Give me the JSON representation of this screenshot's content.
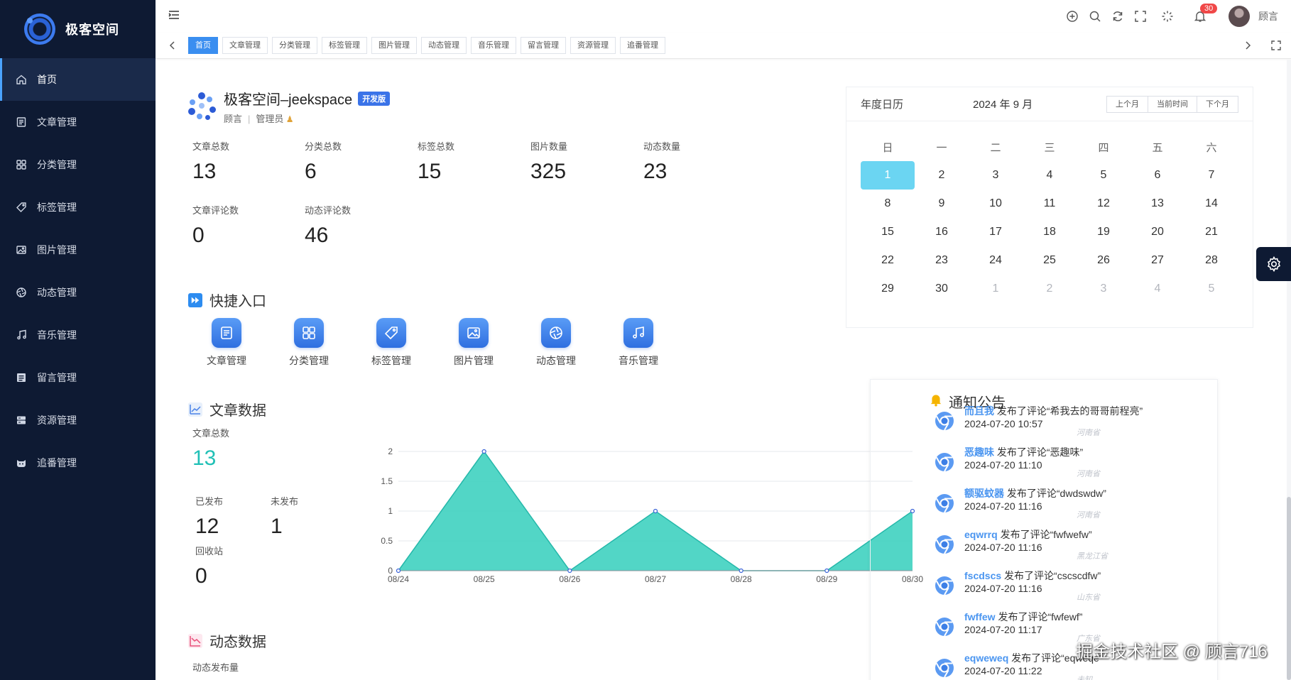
{
  "app": {
    "logo_text": "极客空间"
  },
  "sidebar": {
    "items": [
      {
        "label": "首页",
        "icon": "home-icon"
      },
      {
        "label": "文章管理",
        "icon": "article-icon"
      },
      {
        "label": "分类管理",
        "icon": "category-icon"
      },
      {
        "label": "标签管理",
        "icon": "tag-icon"
      },
      {
        "label": "图片管理",
        "icon": "image-icon"
      },
      {
        "label": "动态管理",
        "icon": "aperture-icon"
      },
      {
        "label": "音乐管理",
        "icon": "music-icon"
      },
      {
        "label": "留言管理",
        "icon": "message-icon"
      },
      {
        "label": "资源管理",
        "icon": "resource-icon"
      },
      {
        "label": "追番管理",
        "icon": "anime-icon"
      }
    ]
  },
  "topbar": {
    "badge_count": "30",
    "username": "顾言"
  },
  "tabs": [
    "首页",
    "文章管理",
    "分类管理",
    "标签管理",
    "图片管理",
    "动态管理",
    "音乐管理",
    "留言管理",
    "资源管理",
    "追番管理"
  ],
  "profile": {
    "name": "极客空间–jeekspace",
    "badge": "开发版",
    "user": "顾言",
    "role": "管理员"
  },
  "stats": [
    {
      "label": "文章总数",
      "value": "13"
    },
    {
      "label": "分类总数",
      "value": "6"
    },
    {
      "label": "标签总数",
      "value": "15"
    },
    {
      "label": "图片数量",
      "value": "325"
    },
    {
      "label": "动态数量",
      "value": "23"
    },
    {
      "label": "文章评论数",
      "value": "0"
    },
    {
      "label": "动态评论数",
      "value": "46"
    }
  ],
  "quick": {
    "title": "快捷入口",
    "items": [
      {
        "label": "文章管理",
        "icon": "article-icon"
      },
      {
        "label": "分类管理",
        "icon": "category-icon"
      },
      {
        "label": "标签管理",
        "icon": "tag-icon"
      },
      {
        "label": "图片管理",
        "icon": "image-icon"
      },
      {
        "label": "动态管理",
        "icon": "aperture-icon"
      },
      {
        "label": "音乐管理",
        "icon": "music-icon"
      }
    ]
  },
  "article_data": {
    "title": "文章数据",
    "total_label": "文章总数",
    "total": "13",
    "published_label": "已发布",
    "published": "12",
    "unpublished_label": "未发布",
    "unpublished": "1",
    "recycle_label": "回收站",
    "recycle": "0"
  },
  "dynamic_data": {
    "title": "动态数据",
    "sub_label": "动态发布量"
  },
  "chart_data": {
    "type": "area",
    "x": [
      "08/24",
      "08/25",
      "08/26",
      "08/27",
      "08/28",
      "08/29",
      "08/30"
    ],
    "values": [
      0,
      2,
      0,
      1,
      0,
      0,
      1
    ],
    "ylim": [
      0,
      2
    ],
    "yticks": [
      "0",
      "0.5",
      "1",
      "1.5",
      "2"
    ],
    "grid": true,
    "color": "#3fd1c0"
  },
  "calendar": {
    "title": "年度日历",
    "month_label": "2024 年 9 月",
    "buttons": [
      "上个月",
      "当前时间",
      "下个月"
    ],
    "weekdays": [
      "日",
      "一",
      "二",
      "三",
      "四",
      "五",
      "六"
    ],
    "days": [
      {
        "d": "1",
        "sel": true
      },
      {
        "d": "2"
      },
      {
        "d": "3"
      },
      {
        "d": "4"
      },
      {
        "d": "5"
      },
      {
        "d": "6"
      },
      {
        "d": "7"
      },
      {
        "d": "8"
      },
      {
        "d": "9"
      },
      {
        "d": "10"
      },
      {
        "d": "11"
      },
      {
        "d": "12"
      },
      {
        "d": "13"
      },
      {
        "d": "14"
      },
      {
        "d": "15"
      },
      {
        "d": "16"
      },
      {
        "d": "17"
      },
      {
        "d": "18"
      },
      {
        "d": "19"
      },
      {
        "d": "20"
      },
      {
        "d": "21"
      },
      {
        "d": "22"
      },
      {
        "d": "23"
      },
      {
        "d": "24"
      },
      {
        "d": "25"
      },
      {
        "d": "26"
      },
      {
        "d": "27"
      },
      {
        "d": "28"
      },
      {
        "d": "29"
      },
      {
        "d": "30"
      },
      {
        "d": "1",
        "other": true
      },
      {
        "d": "2",
        "other": true
      },
      {
        "d": "3",
        "other": true
      },
      {
        "d": "4",
        "other": true
      },
      {
        "d": "5",
        "other": true
      }
    ],
    "selected_color": "#6bd5f2"
  },
  "notice": {
    "title": "通知公告",
    "items": [
      {
        "user": "而且我",
        "action": "发布了评论“希我去的哥哥前程亮”",
        "time": "2024-07-20 10:57",
        "loc": "河南省"
      },
      {
        "user": "恶趣味",
        "action": "发布了评论“恶趣味”",
        "time": "2024-07-20 11:10",
        "loc": "河南省"
      },
      {
        "user": "额驱蚊器",
        "action": "发布了评论“dwdswdw”",
        "time": "2024-07-20 11:16",
        "loc": "河南省"
      },
      {
        "user": "eqwrrq",
        "action": "发布了评论“fwfwefw”",
        "time": "2024-07-20 11:16",
        "loc": "黑龙江省"
      },
      {
        "user": "fscdscs",
        "action": "发布了评论“cscscdfw”",
        "time": "2024-07-20 11:16",
        "loc": "山东省"
      },
      {
        "user": "fwffew",
        "action": "发布了评论“fwfewf”",
        "time": "2024-07-20 11:17",
        "loc": "广东省"
      },
      {
        "user": "eqweweq",
        "action": "发布了评论“eqweqe”",
        "time": "2024-07-20 11:22",
        "loc": "未知"
      }
    ]
  },
  "watermark": "掘金技术社区 @ 顾言716",
  "colors": {
    "sidebar_bg": "#0e1a33",
    "accent": "#3a8ef0",
    "teal": "#21c0b6"
  }
}
